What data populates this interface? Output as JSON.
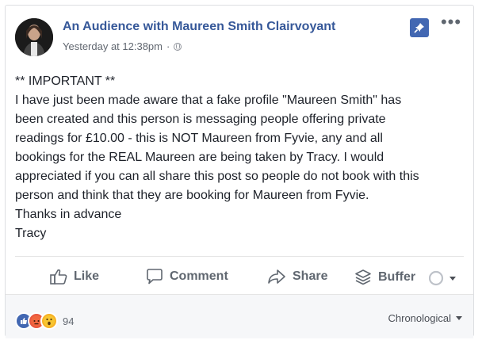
{
  "post": {
    "page_name": "An Audience with Maureen Smith Clairvoyant",
    "timestamp": "Yesterday at 12:38pm",
    "separator": "·",
    "privacy_icon": "globe-icon",
    "lines": [
      "** IMPORTANT **",
      "I have just been made aware that a fake profile \"Maureen Smith\" has",
      "been created and this person is messaging people offering private",
      "readings for £10.00 - this is NOT Maureen from Fyvie, any and all",
      "bookings for the REAL Maureen are being taken by Tracy. I would",
      "appreciated if you can all share this post so people do not book with this",
      "person and think that they are booking for Maureen from Fyvie.",
      "Thanks in advance",
      "Tracy"
    ]
  },
  "actions": {
    "like_label": "Like",
    "comment_label": "Comment",
    "share_label": "Share",
    "buffer_label": "Buffer"
  },
  "footer": {
    "reaction_count": "94",
    "sort_label": "Chronological"
  },
  "colors": {
    "link": "#365899",
    "accent": "#4267b2",
    "muted": "#606770"
  }
}
